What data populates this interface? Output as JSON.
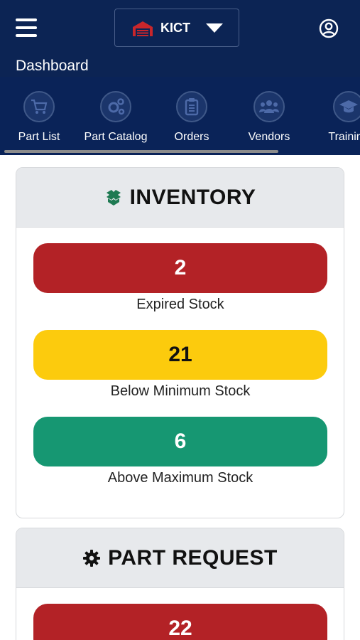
{
  "header": {
    "site": "KICT",
    "page_title": "Dashboard"
  },
  "nav": [
    {
      "label": "Part List",
      "icon": "cart-icon"
    },
    {
      "label": "Part Catalog",
      "icon": "gears-icon"
    },
    {
      "label": "Orders",
      "icon": "clipboard-icon"
    },
    {
      "label": "Vendors",
      "icon": "people-icon"
    },
    {
      "label": "Training",
      "icon": "graduation-cap-icon"
    }
  ],
  "inventory": {
    "title": "INVENTORY",
    "stats": [
      {
        "value": "2",
        "label": "Expired Stock",
        "color": "#b32226"
      },
      {
        "value": "21",
        "label": "Below Minimum Stock",
        "color": "#fccb0d"
      },
      {
        "value": "6",
        "label": "Above Maximum Stock",
        "color": "#169772"
      }
    ]
  },
  "part_request": {
    "title": "PART REQUEST",
    "stats": [
      {
        "value": "22",
        "color": "#b32226"
      }
    ]
  },
  "colors": {
    "header_bg": "#0c2454",
    "nav_bg": "#0a2358",
    "inventory_icon": "#1e7a52",
    "warehouse_icon": "#c8262b"
  }
}
